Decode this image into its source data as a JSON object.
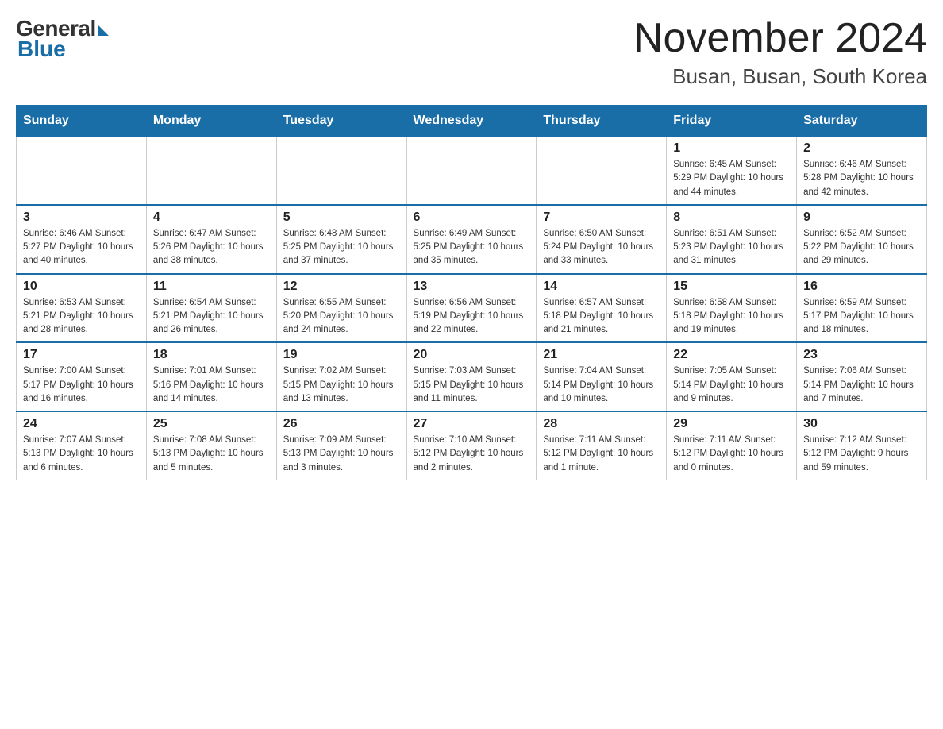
{
  "logo": {
    "general": "General",
    "blue": "Blue"
  },
  "title": "November 2024",
  "subtitle": "Busan, Busan, South Korea",
  "weekdays": [
    "Sunday",
    "Monday",
    "Tuesday",
    "Wednesday",
    "Thursday",
    "Friday",
    "Saturday"
  ],
  "weeks": [
    [
      {
        "day": "",
        "info": ""
      },
      {
        "day": "",
        "info": ""
      },
      {
        "day": "",
        "info": ""
      },
      {
        "day": "",
        "info": ""
      },
      {
        "day": "",
        "info": ""
      },
      {
        "day": "1",
        "info": "Sunrise: 6:45 AM\nSunset: 5:29 PM\nDaylight: 10 hours\nand 44 minutes."
      },
      {
        "day": "2",
        "info": "Sunrise: 6:46 AM\nSunset: 5:28 PM\nDaylight: 10 hours\nand 42 minutes."
      }
    ],
    [
      {
        "day": "3",
        "info": "Sunrise: 6:46 AM\nSunset: 5:27 PM\nDaylight: 10 hours\nand 40 minutes."
      },
      {
        "day": "4",
        "info": "Sunrise: 6:47 AM\nSunset: 5:26 PM\nDaylight: 10 hours\nand 38 minutes."
      },
      {
        "day": "5",
        "info": "Sunrise: 6:48 AM\nSunset: 5:25 PM\nDaylight: 10 hours\nand 37 minutes."
      },
      {
        "day": "6",
        "info": "Sunrise: 6:49 AM\nSunset: 5:25 PM\nDaylight: 10 hours\nand 35 minutes."
      },
      {
        "day": "7",
        "info": "Sunrise: 6:50 AM\nSunset: 5:24 PM\nDaylight: 10 hours\nand 33 minutes."
      },
      {
        "day": "8",
        "info": "Sunrise: 6:51 AM\nSunset: 5:23 PM\nDaylight: 10 hours\nand 31 minutes."
      },
      {
        "day": "9",
        "info": "Sunrise: 6:52 AM\nSunset: 5:22 PM\nDaylight: 10 hours\nand 29 minutes."
      }
    ],
    [
      {
        "day": "10",
        "info": "Sunrise: 6:53 AM\nSunset: 5:21 PM\nDaylight: 10 hours\nand 28 minutes."
      },
      {
        "day": "11",
        "info": "Sunrise: 6:54 AM\nSunset: 5:21 PM\nDaylight: 10 hours\nand 26 minutes."
      },
      {
        "day": "12",
        "info": "Sunrise: 6:55 AM\nSunset: 5:20 PM\nDaylight: 10 hours\nand 24 minutes."
      },
      {
        "day": "13",
        "info": "Sunrise: 6:56 AM\nSunset: 5:19 PM\nDaylight: 10 hours\nand 22 minutes."
      },
      {
        "day": "14",
        "info": "Sunrise: 6:57 AM\nSunset: 5:18 PM\nDaylight: 10 hours\nand 21 minutes."
      },
      {
        "day": "15",
        "info": "Sunrise: 6:58 AM\nSunset: 5:18 PM\nDaylight: 10 hours\nand 19 minutes."
      },
      {
        "day": "16",
        "info": "Sunrise: 6:59 AM\nSunset: 5:17 PM\nDaylight: 10 hours\nand 18 minutes."
      }
    ],
    [
      {
        "day": "17",
        "info": "Sunrise: 7:00 AM\nSunset: 5:17 PM\nDaylight: 10 hours\nand 16 minutes."
      },
      {
        "day": "18",
        "info": "Sunrise: 7:01 AM\nSunset: 5:16 PM\nDaylight: 10 hours\nand 14 minutes."
      },
      {
        "day": "19",
        "info": "Sunrise: 7:02 AM\nSunset: 5:15 PM\nDaylight: 10 hours\nand 13 minutes."
      },
      {
        "day": "20",
        "info": "Sunrise: 7:03 AM\nSunset: 5:15 PM\nDaylight: 10 hours\nand 11 minutes."
      },
      {
        "day": "21",
        "info": "Sunrise: 7:04 AM\nSunset: 5:14 PM\nDaylight: 10 hours\nand 10 minutes."
      },
      {
        "day": "22",
        "info": "Sunrise: 7:05 AM\nSunset: 5:14 PM\nDaylight: 10 hours\nand 9 minutes."
      },
      {
        "day": "23",
        "info": "Sunrise: 7:06 AM\nSunset: 5:14 PM\nDaylight: 10 hours\nand 7 minutes."
      }
    ],
    [
      {
        "day": "24",
        "info": "Sunrise: 7:07 AM\nSunset: 5:13 PM\nDaylight: 10 hours\nand 6 minutes."
      },
      {
        "day": "25",
        "info": "Sunrise: 7:08 AM\nSunset: 5:13 PM\nDaylight: 10 hours\nand 5 minutes."
      },
      {
        "day": "26",
        "info": "Sunrise: 7:09 AM\nSunset: 5:13 PM\nDaylight: 10 hours\nand 3 minutes."
      },
      {
        "day": "27",
        "info": "Sunrise: 7:10 AM\nSunset: 5:12 PM\nDaylight: 10 hours\nand 2 minutes."
      },
      {
        "day": "28",
        "info": "Sunrise: 7:11 AM\nSunset: 5:12 PM\nDaylight: 10 hours\nand 1 minute."
      },
      {
        "day": "29",
        "info": "Sunrise: 7:11 AM\nSunset: 5:12 PM\nDaylight: 10 hours\nand 0 minutes."
      },
      {
        "day": "30",
        "info": "Sunrise: 7:12 AM\nSunset: 5:12 PM\nDaylight: 9 hours\nand 59 minutes."
      }
    ]
  ]
}
